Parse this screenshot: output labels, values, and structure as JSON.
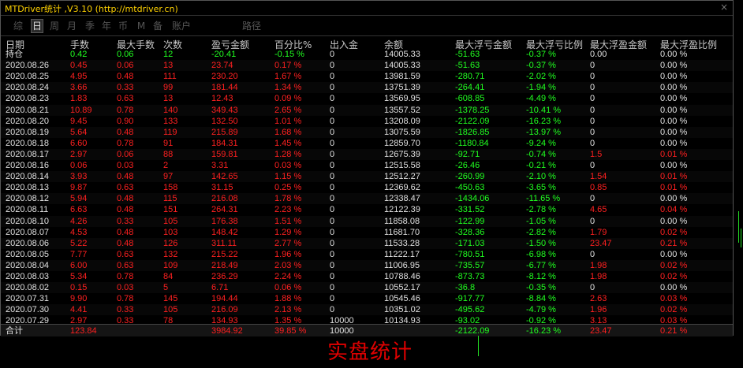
{
  "window": {
    "title": "MTDriver统计 ,V3.10 (http://mtdriver.cn)",
    "close_label": "×"
  },
  "tabs": [
    {
      "label": "综",
      "active": false
    },
    {
      "label": "日",
      "active": true
    },
    {
      "label": "周",
      "active": false
    },
    {
      "label": "月",
      "active": false
    },
    {
      "label": "季",
      "active": false
    },
    {
      "label": "年",
      "active": false
    },
    {
      "label": "币",
      "active": false
    },
    {
      "label": "M",
      "active": false
    },
    {
      "label": "备",
      "active": false
    },
    {
      "label": "账户",
      "active": false
    },
    {
      "label": "路径",
      "active": false
    }
  ],
  "columns": [
    "日期",
    "手数",
    "最大手数",
    "次数",
    "盈亏金额",
    "百分比%",
    "出入金",
    "余额",
    "最大浮亏金额",
    "最大浮亏比例",
    "最大浮盈金额",
    "最大浮盈比例"
  ],
  "colors": {
    "positive": "#ff2020",
    "negative": "#20ff20",
    "neutral": "#e0e0e0",
    "title": "#ffd200",
    "tab_inactive": "#555555"
  },
  "rows": [
    {
      "k": "hold",
      "cells": [
        "持仓",
        "0.42",
        "0.06",
        "12",
        "-20.41",
        "-0.15 %",
        "0",
        "14005.33",
        "-51.63",
        "-0.37 %",
        "0.00",
        "0.00 %"
      ]
    },
    {
      "k": "pos",
      "cells": [
        "2020.08.26",
        "0.45",
        "0.06",
        "13",
        "23.74",
        "0.17 %",
        "0",
        "14005.33",
        "-51.63",
        "-0.37 %",
        "0",
        "0.00 %"
      ]
    },
    {
      "k": "pos",
      "cells": [
        "2020.08.25",
        "4.95",
        "0.48",
        "111",
        "230.20",
        "1.67 %",
        "0",
        "13981.59",
        "-280.71",
        "-2.02 %",
        "0",
        "0.00 %"
      ]
    },
    {
      "k": "pos",
      "cells": [
        "2020.08.24",
        "3.66",
        "0.33",
        "99",
        "181.44",
        "1.34 %",
        "0",
        "13751.39",
        "-264.41",
        "-1.94 %",
        "0",
        "0.00 %"
      ]
    },
    {
      "k": "pos",
      "cells": [
        "2020.08.23",
        "1.83",
        "0.63",
        "13",
        "12.43",
        "0.09 %",
        "0",
        "13569.95",
        "-608.85",
        "-4.49 %",
        "0",
        "0.00 %"
      ]
    },
    {
      "k": "pos",
      "cells": [
        "2020.08.21",
        "10.89",
        "0.78",
        "140",
        "349.43",
        "2.65 %",
        "0",
        "13557.52",
        "-1378.25",
        "-10.41 %",
        "0",
        "0.00 %"
      ]
    },
    {
      "k": "pos",
      "cells": [
        "2020.08.20",
        "9.45",
        "0.90",
        "133",
        "132.50",
        "1.01 %",
        "0",
        "13208.09",
        "-2122.09",
        "-16.23 %",
        "0",
        "0.00 %"
      ]
    },
    {
      "k": "pos",
      "cells": [
        "2020.08.19",
        "5.64",
        "0.48",
        "119",
        "215.89",
        "1.68 %",
        "0",
        "13075.59",
        "-1826.85",
        "-13.97 %",
        "0",
        "0.00 %"
      ]
    },
    {
      "k": "pos",
      "cells": [
        "2020.08.18",
        "6.60",
        "0.78",
        "91",
        "184.31",
        "1.45 %",
        "0",
        "12859.70",
        "-1180.84",
        "-9.24 %",
        "0",
        "0.00 %"
      ]
    },
    {
      "k": "pos",
      "cells": [
        "2020.08.17",
        "2.97",
        "0.06",
        "88",
        "159.81",
        "1.28 %",
        "0",
        "12675.39",
        "-92.71",
        "-0.74 %",
        "1.5",
        "0.01 %"
      ]
    },
    {
      "k": "pos",
      "cells": [
        "2020.08.16",
        "0.06",
        "0.03",
        "2",
        "3.31",
        "0.03 %",
        "0",
        "12515.58",
        "-26.46",
        "-0.21 %",
        "0",
        "0.00 %"
      ]
    },
    {
      "k": "pos",
      "cells": [
        "2020.08.14",
        "3.93",
        "0.48",
        "97",
        "142.65",
        "1.15 %",
        "0",
        "12512.27",
        "-260.99",
        "-2.10 %",
        "1.54",
        "0.01 %"
      ]
    },
    {
      "k": "pos",
      "cells": [
        "2020.08.13",
        "9.87",
        "0.63",
        "158",
        "31.15",
        "0.25 %",
        "0",
        "12369.62",
        "-450.63",
        "-3.65 %",
        "0.85",
        "0.01 %"
      ]
    },
    {
      "k": "pos",
      "cells": [
        "2020.08.12",
        "5.94",
        "0.48",
        "115",
        "216.08",
        "1.78 %",
        "0",
        "12338.47",
        "-1434.06",
        "-11.65 %",
        "0",
        "0.00 %"
      ]
    },
    {
      "k": "pos",
      "cells": [
        "2020.08.11",
        "6.63",
        "0.48",
        "151",
        "264.31",
        "2.23 %",
        "0",
        "12122.39",
        "-331.52",
        "-2.78 %",
        "4.65",
        "0.04 %"
      ]
    },
    {
      "k": "pos",
      "cells": [
        "2020.08.10",
        "4.26",
        "0.33",
        "105",
        "176.38",
        "1.51 %",
        "0",
        "11858.08",
        "-122.99",
        "-1.05 %",
        "0",
        "0.00 %"
      ]
    },
    {
      "k": "pos",
      "cells": [
        "2020.08.07",
        "4.53",
        "0.48",
        "103",
        "148.42",
        "1.29 %",
        "0",
        "11681.70",
        "-328.36",
        "-2.82 %",
        "1.79",
        "0.02 %"
      ]
    },
    {
      "k": "pos",
      "cells": [
        "2020.08.06",
        "5.22",
        "0.48",
        "126",
        "311.11",
        "2.77 %",
        "0",
        "11533.28",
        "-171.03",
        "-1.50 %",
        "23.47",
        "0.21 %"
      ]
    },
    {
      "k": "pos",
      "cells": [
        "2020.08.05",
        "7.77",
        "0.63",
        "132",
        "215.22",
        "1.96 %",
        "0",
        "11222.17",
        "-780.51",
        "-6.98 %",
        "0",
        "0.00 %"
      ]
    },
    {
      "k": "pos",
      "cells": [
        "2020.08.04",
        "6.00",
        "0.63",
        "109",
        "218.49",
        "2.03 %",
        "0",
        "11006.95",
        "-735.57",
        "-6.77 %",
        "1.98",
        "0.02 %"
      ]
    },
    {
      "k": "pos",
      "cells": [
        "2020.08.03",
        "5.34",
        "0.78",
        "84",
        "236.29",
        "2.24 %",
        "0",
        "10788.46",
        "-873.73",
        "-8.12 %",
        "1.98",
        "0.02 %"
      ]
    },
    {
      "k": "pos",
      "cells": [
        "2020.08.02",
        "0.15",
        "0.03",
        "5",
        "6.71",
        "0.06 %",
        "0",
        "10552.17",
        "-36.8",
        "-0.35 %",
        "0",
        "0.00 %"
      ]
    },
    {
      "k": "pos",
      "cells": [
        "2020.07.31",
        "9.90",
        "0.78",
        "145",
        "194.44",
        "1.88 %",
        "0",
        "10545.46",
        "-917.77",
        "-8.84 %",
        "2.63",
        "0.03 %"
      ]
    },
    {
      "k": "pos",
      "cells": [
        "2020.07.30",
        "4.41",
        "0.33",
        "105",
        "216.09",
        "2.13 %",
        "0",
        "10351.02",
        "-495.62",
        "-4.79 %",
        "1.96",
        "0.02 %"
      ]
    },
    {
      "k": "pos",
      "cells": [
        "2020.07.29",
        "2.97",
        "0.33",
        "78",
        "134.93",
        "1.35 %",
        "10000",
        "10134.93",
        "-93.02",
        "-0.92 %",
        "3.13",
        "0.03 %"
      ]
    }
  ],
  "total": [
    "合计",
    "123.84",
    "",
    "",
    "3984.92",
    "39.85 %",
    "10000",
    "",
    "-2122.09",
    "-16.23 %",
    "23.47",
    "0.21 %"
  ],
  "watermark": "实盘统计"
}
